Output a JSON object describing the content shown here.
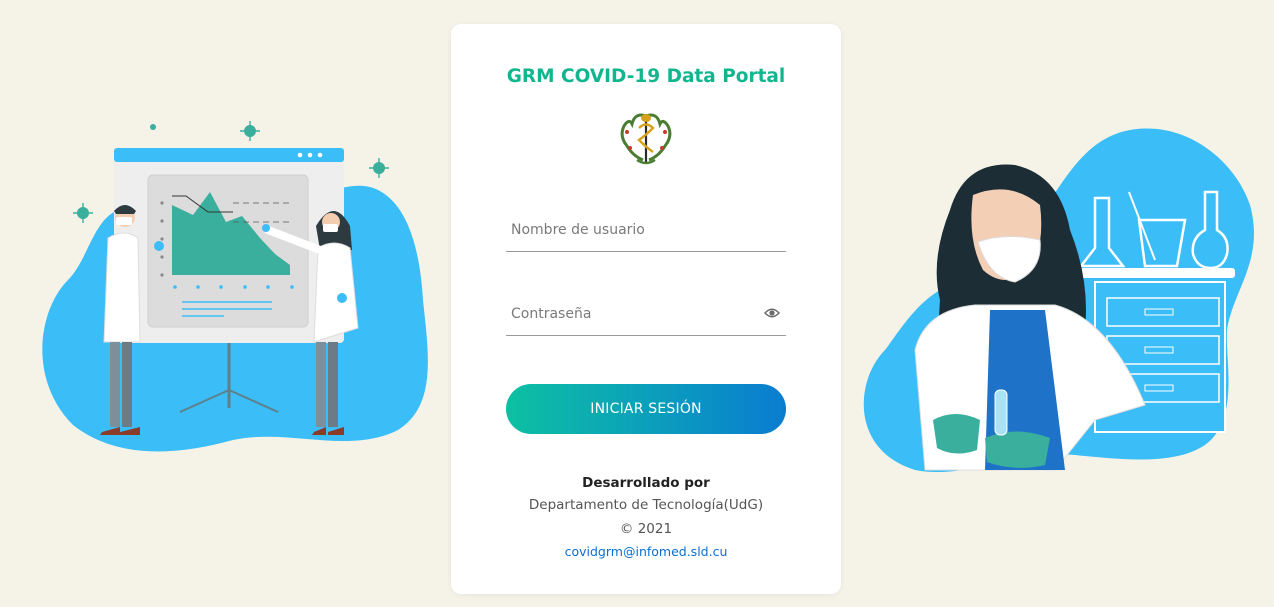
{
  "login": {
    "title": "GRM COVID-19 Data Portal",
    "username_placeholder": "Nombre de usuario",
    "password_placeholder": "Contraseña",
    "submit_label": "INICIAR SESIÓN"
  },
  "footer": {
    "developed_by": "Desarrollado por",
    "department": "Departamento de Tecnología(UdG)",
    "copyright": "© 2021",
    "email": "covidgrm@infomed.sld.cu"
  },
  "colors": {
    "page_background": "#f5f3e8",
    "title": "#11b68f",
    "button_gradient_start": "#0cc0a2",
    "button_gradient_end": "#0a7cd0",
    "link": "#0b6fd0",
    "illustration_blue": "#3bbdf8",
    "illustration_teal": "#3aaf9d"
  },
  "icons": {
    "seal": "medical-seal-icon",
    "password_toggle": "eye-icon"
  }
}
